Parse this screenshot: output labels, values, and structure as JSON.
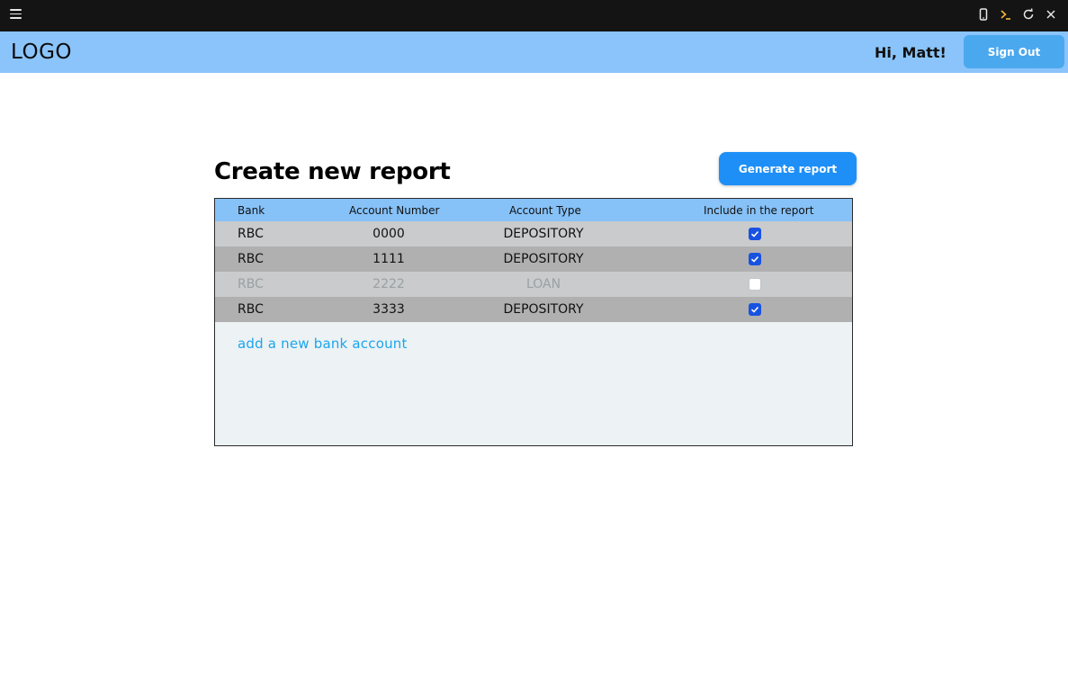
{
  "window": {
    "icons": [
      "menu-icon",
      "device-icon",
      "console-icon",
      "reload-icon",
      "close-icon"
    ]
  },
  "header": {
    "logo": "LOGO",
    "greeting": "Hi, Matt!",
    "signout_label": "Sign Out"
  },
  "main": {
    "title": "Create new report",
    "generate_label": "Generate report",
    "table": {
      "columns": [
        "Bank",
        "Account Number",
        "Account Type",
        "Include in the report"
      ],
      "rows": [
        {
          "bank": "RBC",
          "number": "0000",
          "type": "DEPOSITORY",
          "included": true
        },
        {
          "bank": "RBC",
          "number": "1111",
          "type": "DEPOSITORY",
          "included": true
        },
        {
          "bank": "RBC",
          "number": "2222",
          "type": "LOAN",
          "included": false
        },
        {
          "bank": "RBC",
          "number": "3333",
          "type": "DEPOSITORY",
          "included": true
        }
      ]
    },
    "add_account_label": "add a new bank account"
  },
  "colors": {
    "header_bg": "#8ac4fa",
    "signout_bg": "#4aa8ef",
    "generate_bg": "#1e8ff7",
    "checkbox_on": "#1852e0",
    "link": "#1ba6ec"
  }
}
